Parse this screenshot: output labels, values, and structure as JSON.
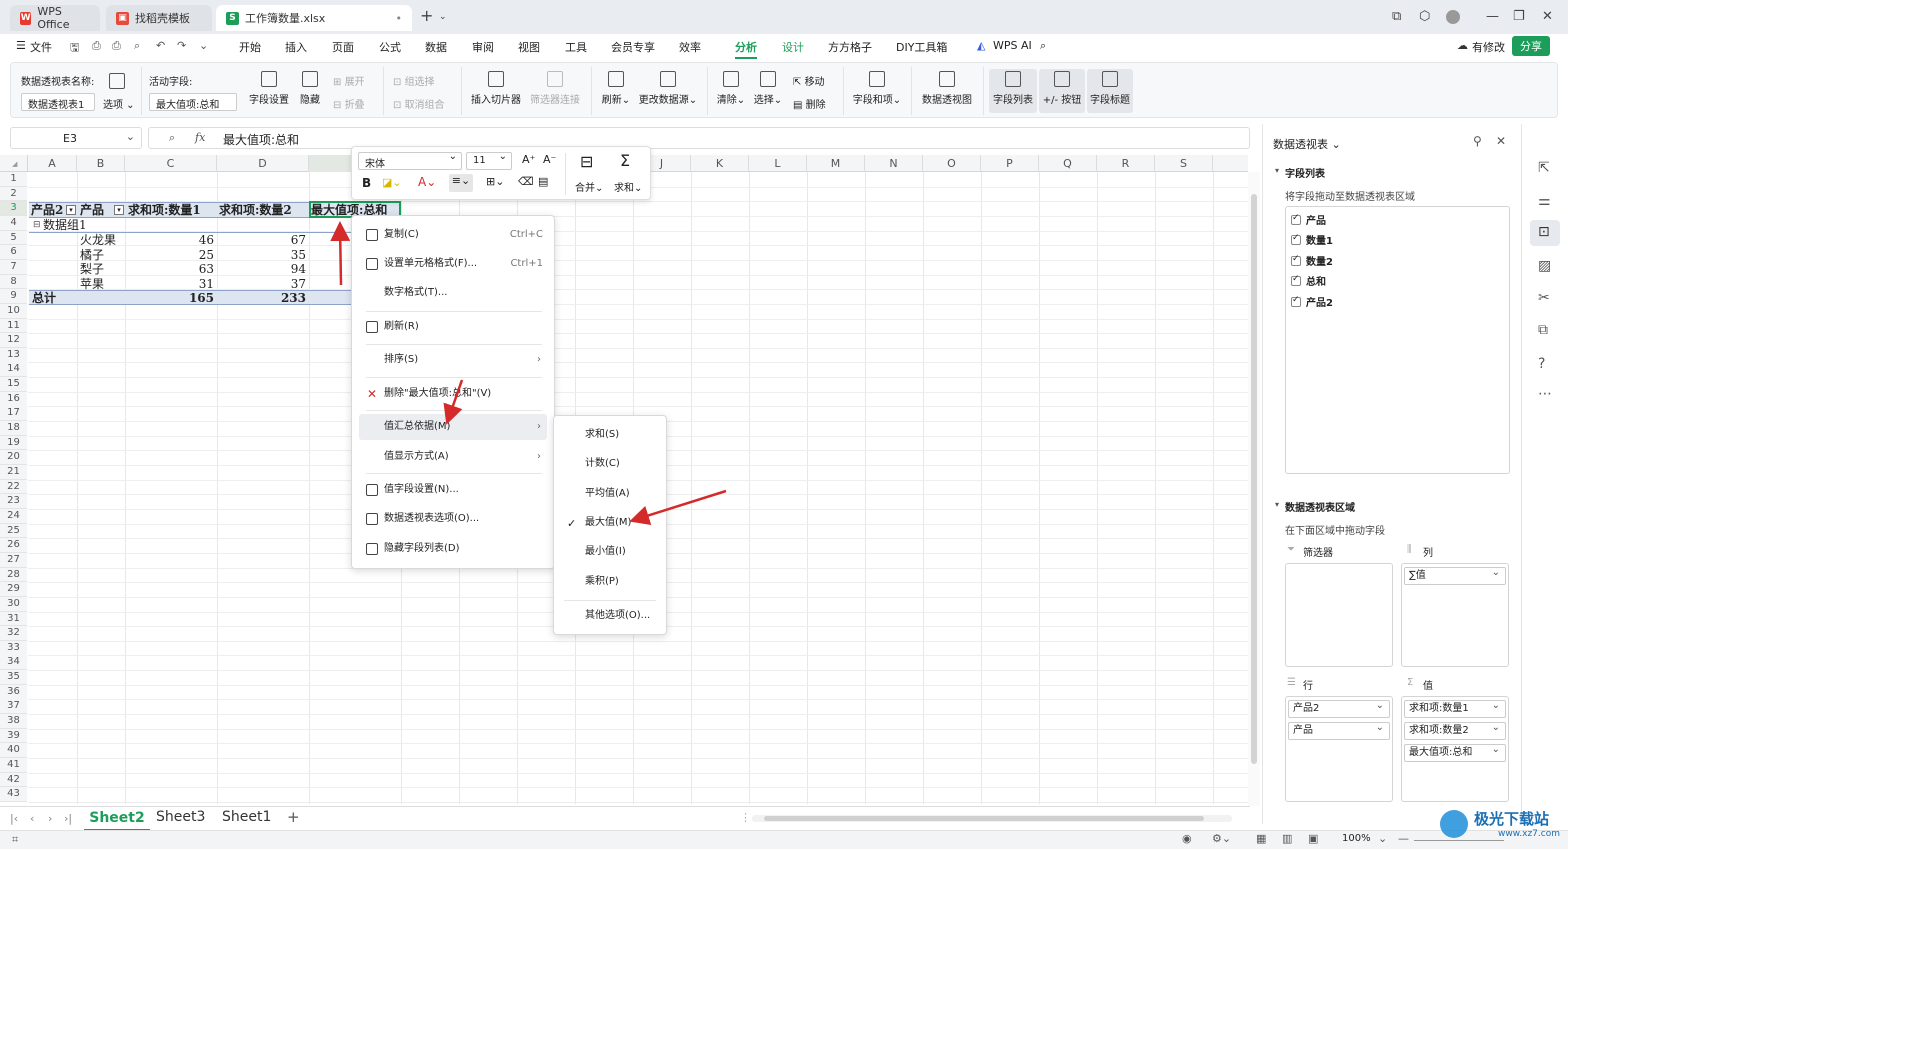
{
  "titlebar": {
    "tabs": [
      {
        "label": "WPS Office",
        "icon": "wps-logo-icon",
        "color": "#e63b2e"
      },
      {
        "label": "找稻壳模板",
        "icon": "docer-icon",
        "color": "#e64a3c"
      },
      {
        "label": "工作簿数量.xlsx",
        "icon": "spreadsheet-s-icon",
        "color": "#1c9e5a"
      }
    ]
  },
  "menubar": {
    "file": "文件",
    "items": [
      "开始",
      "插入",
      "页面",
      "公式",
      "数据",
      "审阅",
      "视图",
      "工具",
      "会员专享",
      "效率",
      "分析",
      "设计",
      "方方格子",
      "DIY工具箱",
      "WPS AI"
    ],
    "active": "分析",
    "modified": "有修改",
    "share": "分享"
  },
  "ribbon": {
    "pivot_name_label": "数据透视表名称:",
    "pivot_name_value": "数据透视表1",
    "options": "选项",
    "active_field_label": "活动字段:",
    "active_field_value": "最大值项:总和",
    "field_settings": "字段设置",
    "hide": "隐藏",
    "expand": "展开",
    "collapse": "折叠",
    "group_select": "组选择",
    "ungroup": "取消组合",
    "insert_slicer": "插入切片器",
    "filter_connect": "筛选器连接",
    "refresh": "刷新",
    "change_source": "更改数据源",
    "clear": "清除",
    "select": "选择",
    "move": "移动",
    "delete": "删除",
    "fields_items": "字段和项",
    "pivot_chart": "数据透视图",
    "field_list": "字段列表",
    "plusminus": "+/- 按钮",
    "field_headers": "字段标题"
  },
  "formula_bar": {
    "cell_ref": "E3",
    "fx": "fx",
    "content": "最大值项:总和"
  },
  "grid": {
    "columns": [
      "A",
      "B",
      "C",
      "D",
      "E",
      "F",
      "G",
      "H",
      "I",
      "J",
      "K",
      "L",
      "M",
      "N",
      "O",
      "P",
      "Q",
      "R",
      "S"
    ],
    "rows": [
      "1",
      "2",
      "3",
      "4",
      "5",
      "6",
      "7",
      "8",
      "9",
      "10",
      "11",
      "12",
      "13",
      "14",
      "15",
      "16",
      "17",
      "18",
      "19",
      "20",
      "21",
      "22",
      "23",
      "24",
      "25",
      "26",
      "27",
      "28",
      "29",
      "30",
      "31",
      "32",
      "33",
      "34",
      "35",
      "36",
      "37",
      "38",
      "39",
      "40",
      "41",
      "42",
      "43"
    ],
    "header_row": [
      "产品2",
      "产品",
      "求和项:数量1",
      "求和项:数量2",
      "最大值项:总和"
    ],
    "group_label": "数据组1",
    "data_rows": [
      {
        "product": "火龙果",
        "q1": "46",
        "q2": "67"
      },
      {
        "product": "橘子",
        "q1": "25",
        "q2": "35"
      },
      {
        "product": "梨子",
        "q1": "63",
        "q2": "94"
      },
      {
        "product": "苹果",
        "q1": "31",
        "q2": "37"
      }
    ],
    "total_label": "总计",
    "total_q1": "165",
    "total_q2": "233"
  },
  "mini_toolbar": {
    "font": "宋体",
    "size": "11",
    "merge": "合并",
    "sum": "求和"
  },
  "context_menu": {
    "items": [
      {
        "label": "复制(C)",
        "shortcut": "Ctrl+C",
        "icon": "copy-icon"
      },
      {
        "label": "设置单元格格式(F)...",
        "shortcut": "Ctrl+1",
        "icon": "format-cells-icon"
      },
      {
        "label": "数字格式(T)...",
        "shortcut": "",
        "icon": ""
      },
      {
        "label": "刷新(R)",
        "shortcut": "",
        "icon": "refresh-icon"
      },
      {
        "label": "排序(S)",
        "shortcut": "",
        "icon": ""
      },
      {
        "label": "删除\"最大值项:总和\"(V)",
        "shortcut": "",
        "icon": "delete-x-icon"
      },
      {
        "label": "值汇总依据(M)",
        "shortcut": "",
        "icon": ""
      },
      {
        "label": "值显示方式(A)",
        "shortcut": "",
        "icon": ""
      },
      {
        "label": "值字段设置(N)...",
        "shortcut": "",
        "icon": "field-settings-icon"
      },
      {
        "label": "数据透视表选项(O)...",
        "shortcut": "",
        "icon": "pivot-options-icon"
      },
      {
        "label": "隐藏字段列表(D)",
        "shortcut": "",
        "icon": "hide-field-list-icon"
      }
    ],
    "submenu": [
      "求和(S)",
      "计数(C)",
      "平均值(A)",
      "最大值(M)",
      "最小值(I)",
      "乘积(P)",
      "其他选项(O)..."
    ],
    "submenu_checked": "最大值(M)"
  },
  "pane": {
    "title": "数据透视表",
    "field_list_title": "字段列表",
    "field_list_hint": "将字段拖动至数据透视表区域",
    "fields": [
      "产品",
      "数量1",
      "数量2",
      "总和",
      "产品2"
    ],
    "areas_title": "数据透视表区域",
    "areas_hint": "在下面区域中拖动字段",
    "filter_label": "筛选器",
    "column_label": "列",
    "row_label": "行",
    "value_label": "值",
    "column_items": [
      "∑值"
    ],
    "row_items": [
      "产品2",
      "产品"
    ],
    "value_items": [
      "求和项:数量1",
      "求和项:数量2",
      "最大值项:总和"
    ]
  },
  "sheets": {
    "tabs": [
      "Sheet2",
      "Sheet3",
      "Sheet1"
    ],
    "active": "Sheet2"
  },
  "status": {
    "zoom": "100%",
    "watermark": "极光下载站",
    "watermark_url": "www.xz7.com"
  },
  "colors": {
    "accent": "#1c9e5a",
    "pivot_header_bg": "#dde5f1",
    "arrow_red": "#d42a2a"
  }
}
